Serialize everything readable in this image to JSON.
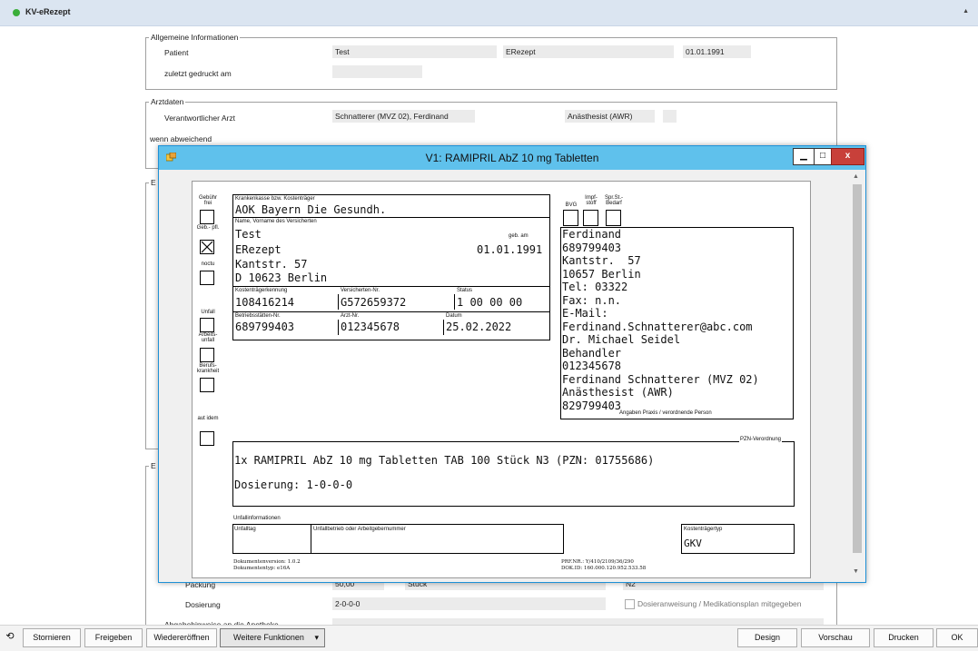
{
  "panel": {
    "title": "KV-eRezept"
  },
  "general": {
    "legend": "Allgemeine Informationen",
    "patient_label": "Patient",
    "patient_first": "Test",
    "patient_last": "ERezept",
    "patient_dob": "01.01.1991",
    "printed_label": "zuletzt gedruckt am",
    "printed_value": ""
  },
  "doctor": {
    "legend": "Arztdaten",
    "resp_label": "Verantwortlicher Arzt",
    "resp_value": "Schnatterer (MVZ 02), Ferdinand",
    "role_value": "Anästhesist (AWR)",
    "deviating_label": "wenn abweichend"
  },
  "background_form": {
    "legend_e1": "E",
    "legend_e2": "E",
    "pack_label": "Packung",
    "pack_value": "50,00",
    "pack_unit": "Stück",
    "pack_size": "N2",
    "dose_label": "Dosierung",
    "dose_value": "2-0-0-0",
    "dose_check_label": "Dosieranweisung / Medikationsplan mitgegeben",
    "dispense_label": "Abgabehinweise an die Apotheke"
  },
  "modal": {
    "title": "V1: RAMIPRIL AbZ 10 mg Tabletten",
    "minimize": "▁",
    "maximize": "□",
    "close": "x"
  },
  "rx": {
    "left_checks": {
      "gebuehr_frei": "Gebühr frei",
      "geb_pfl": "Geb.- pfl.",
      "noctu": "noctu",
      "unfall": "Unfall",
      "arbeitsunfall": "Arbeits- unfall",
      "berufskrankheit": "Berufs- krankheit",
      "aut_idem": "aut idem"
    },
    "insurance_label": "Krankenkasse bzw. Kostenträger",
    "insurance": "AOK Bayern Die Gesundh.",
    "name_label": "Name, Vorname des Versicherten",
    "dob_label": "geb. am",
    "patient_line1": "Test",
    "patient_line2": "ERezept",
    "patient_dob": "01.01.1991",
    "patient_line3": "Kantstr. 57",
    "patient_line4": "D 10623 Berlin",
    "kk_label": "Kostenträgerkennung",
    "kk_value": "108416214",
    "vnr_label": "Versicherten-Nr.",
    "vnr_value": "G572659372",
    "status_label": "Status",
    "status_value": "1 00 00 00",
    "bsnr_label": "Betriebsstätten-Nr.",
    "bsnr_value": "689799403",
    "lanr_label": "Arzt-Nr.",
    "lanr_value": "012345678",
    "date_label": "Datum",
    "date_value": "25.02.2022",
    "bvg": "BVG",
    "impf": "Impf- stoff",
    "spr": "Spr.St.- Bedarf",
    "practice_lines": [
      "Ferdinand",
      "689799403",
      "Kantstr.  57",
      "10657 Berlin",
      "Tel: 03322",
      "Fax: n.n.",
      "E-Mail:",
      "Ferdinand.Schnatterer@abc.com",
      "Dr. Michael Seidel",
      "Behandler",
      "012345678",
      "Ferdinand Schnatterer (MVZ 02)",
      "Anästhesist (AWR)",
      "829799403"
    ],
    "practice_caption": "Angaben Praxis / verordnende Person",
    "pzn_caption": "PZN-Verordnung",
    "prescription": "1x RAMIPRIL AbZ 10 mg Tabletten TAB 100 Stück N3 (PZN: 01755686)",
    "dosage": "Dosierung: 1-0-0-0",
    "accident_caption": "Unfallinformationen",
    "accident_day": "Unfalltag",
    "accident_company": "Unfallbetrieb oder Arbeitgebernummer",
    "payer_type_label": "Kostenträgertyp",
    "payer_type": "GKV",
    "doc_version": "Dokumentenversion: 1.0.2",
    "doc_type": "Dokumententyp: e16A",
    "prf_nr": "PRF.NR.: Y/410/2109/36/290",
    "dok_id": "DOK.ID: 160.000.120.952.533.58"
  },
  "toolbar": {
    "history": "⟲",
    "cancel": "Stornieren",
    "release": "Freigeben",
    "reopen": "Wiedereröffnen",
    "more": "Weitere Funktionen",
    "more_arrow": "▾",
    "design": "Design",
    "preview": "Vorschau",
    "print": "Drucken",
    "ok": "OK"
  }
}
